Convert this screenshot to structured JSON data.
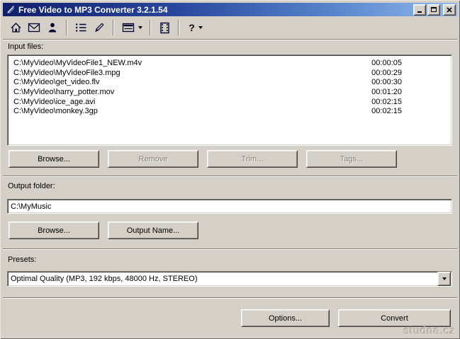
{
  "window": {
    "title": "Free Video to MP3 Converter 3.2.1.54",
    "app_icon": "converter-app-icon",
    "control_icons": [
      "minimize-icon",
      "maximize-icon",
      "close-icon"
    ]
  },
  "toolbar": {
    "icons": [
      {
        "name": "home-icon"
      },
      {
        "name": "mail-icon"
      },
      {
        "name": "user-icon"
      },
      {
        "name": "list-icon"
      },
      {
        "name": "pencil-icon"
      },
      {
        "name": "menu-window-icon",
        "dropdown": true
      },
      {
        "name": "film-strip-icon"
      },
      {
        "name": "help-icon",
        "glyph": "?",
        "dropdown": true
      }
    ]
  },
  "input_files": {
    "label": "Input files:",
    "files": [
      {
        "path": "C:\\MyVideo\\MyVideoFile1_NEW.m4v",
        "duration": "00:00:05"
      },
      {
        "path": "C:\\MyVideo\\MyVideoFile3.mpg",
        "duration": "00:00:29"
      },
      {
        "path": "C:\\MyVideo\\get_video.flv",
        "duration": "00:00:30"
      },
      {
        "path": "C:\\MyVideo\\harry_potter.mov",
        "duration": "00:01:20"
      },
      {
        "path": "C:\\MyVideo\\ice_age.avi",
        "duration": "00:02:15"
      },
      {
        "path": "C:\\MyVideo\\monkey.3gp",
        "duration": "00:02:15"
      }
    ],
    "buttons": [
      {
        "label": "Browse...",
        "enabled": true
      },
      {
        "label": "Remove",
        "enabled": false
      },
      {
        "label": "Trim...",
        "enabled": false
      },
      {
        "label": "Tags...",
        "enabled": false
      }
    ]
  },
  "output_folder": {
    "label": "Output folder:",
    "value": "C:\\MyMusic",
    "browse_label": "Browse...",
    "output_name_label": "Output Name..."
  },
  "presets": {
    "label": "Presets:",
    "selected": "Optimal Quality (MP3, 192 kbps, 48000 Hz, STEREO)"
  },
  "footer": {
    "options_label": "Options...",
    "convert_label": "Convert",
    "watermark": "studna.cz"
  },
  "colors": {
    "window_bg": "#d4d0c8",
    "titlebar_start": "#10206b",
    "titlebar_end": "#93b9ec",
    "disabled_text": "#827f79",
    "list_bg": "#ffffff"
  }
}
